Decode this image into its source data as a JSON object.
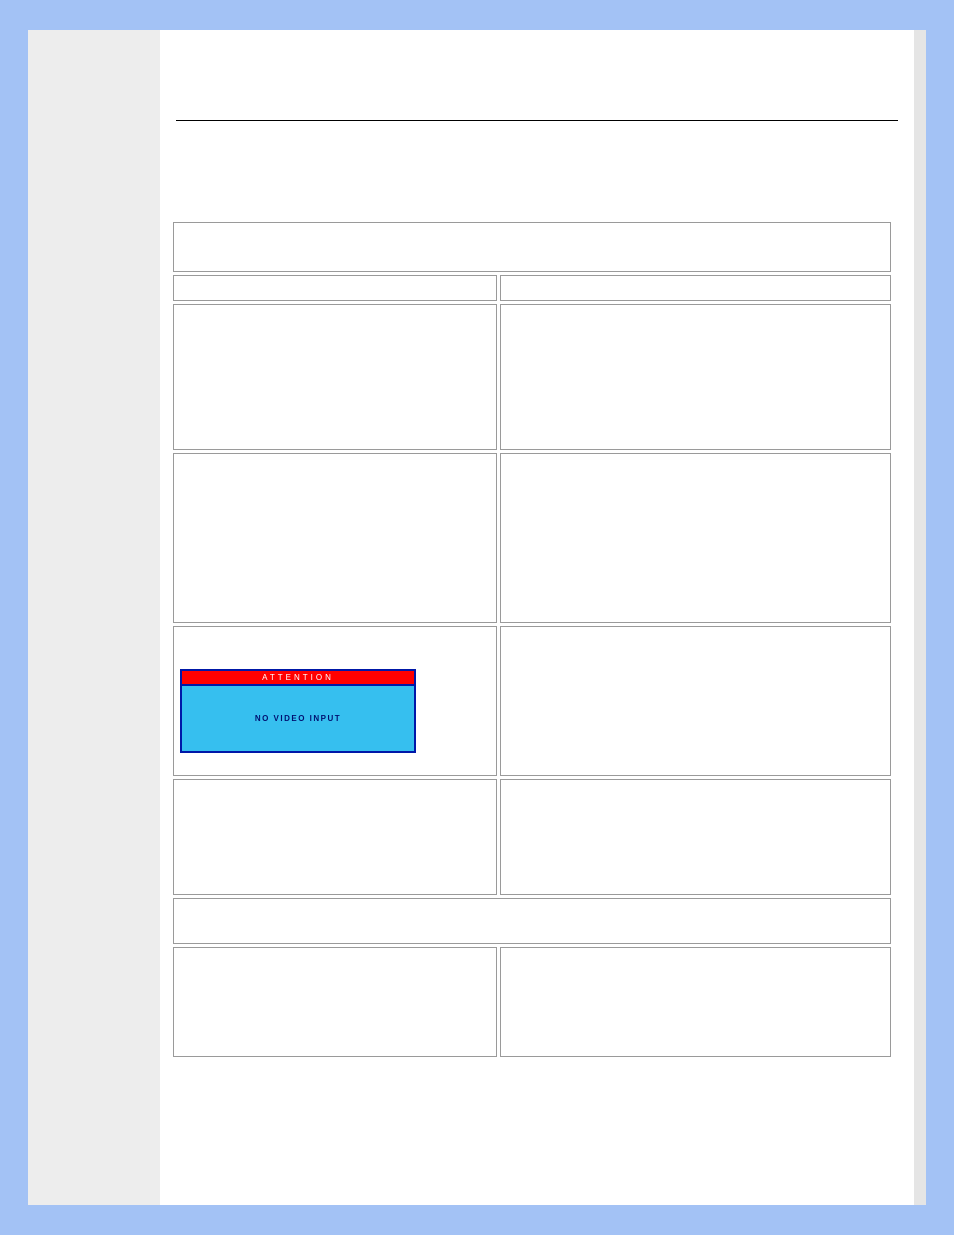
{
  "sidebar": {},
  "content": {
    "title": "",
    "divider": true
  },
  "table": {
    "rows": [
      {
        "type": "merged",
        "cells": [
          ""
        ]
      },
      {
        "type": "small",
        "cells": [
          "",
          ""
        ]
      },
      {
        "type": "large",
        "cells": [
          "",
          ""
        ]
      },
      {
        "type": "taller",
        "cells": [
          "",
          ""
        ]
      },
      {
        "type": "mid",
        "cells": [
          {
            "widget": "no-video",
            "header": "ATTENTION",
            "body": "NO VIDEO INPUT"
          },
          ""
        ]
      },
      {
        "type": "less",
        "cells": [
          "",
          ""
        ]
      },
      {
        "type": "merged2",
        "cells": [
          ""
        ]
      },
      {
        "type": "last",
        "cells": [
          "",
          ""
        ]
      }
    ]
  },
  "colors": {
    "page_bg": "#a3c2f5",
    "sidebar_bg": "#ededed",
    "content_bg": "#ffffff",
    "cell_border": "#9a9a9a",
    "nv_border": "#0018a8",
    "nv_header_bg": "#ff0000",
    "nv_body_bg": "#36bfef"
  }
}
